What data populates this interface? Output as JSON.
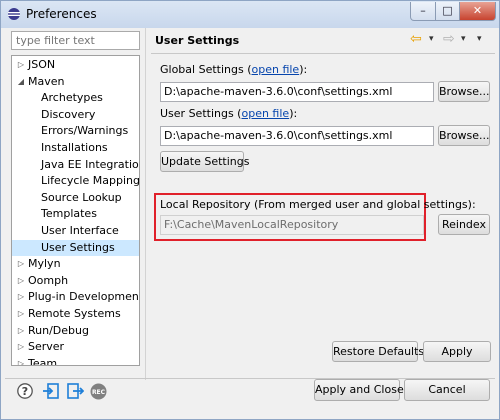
{
  "window": {
    "title": "Preferences",
    "min_glyph": "–",
    "max_glyph": "□",
    "close_glyph": "✕"
  },
  "filter": {
    "placeholder": "type filter text"
  },
  "tree": {
    "items": [
      {
        "label": "JSON",
        "expander": "▷",
        "level": 0
      },
      {
        "label": "Maven",
        "expander": "◢",
        "level": 0
      },
      {
        "label": "Archetypes",
        "expander": "",
        "level": 1
      },
      {
        "label": "Discovery",
        "expander": "",
        "level": 1
      },
      {
        "label": "Errors/Warnings",
        "expander": "",
        "level": 1
      },
      {
        "label": "Installations",
        "expander": "",
        "level": 1
      },
      {
        "label": "Java EE Integration",
        "expander": "",
        "level": 1
      },
      {
        "label": "Lifecycle Mappings",
        "expander": "",
        "level": 1
      },
      {
        "label": "Source Lookup",
        "expander": "",
        "level": 1
      },
      {
        "label": "Templates",
        "expander": "",
        "level": 1
      },
      {
        "label": "User Interface",
        "expander": "",
        "level": 1
      },
      {
        "label": "User Settings",
        "expander": "",
        "level": 1,
        "selected": true
      },
      {
        "label": "Mylyn",
        "expander": "▷",
        "level": 0
      },
      {
        "label": "Oomph",
        "expander": "▷",
        "level": 0
      },
      {
        "label": "Plug-in Development",
        "expander": "▷",
        "level": 0
      },
      {
        "label": "Remote Systems",
        "expander": "▷",
        "level": 0
      },
      {
        "label": "Run/Debug",
        "expander": "▷",
        "level": 0
      },
      {
        "label": "Server",
        "expander": "▷",
        "level": 0
      },
      {
        "label": "Team",
        "expander": "▷",
        "level": 0
      }
    ]
  },
  "page": {
    "title": "User Settings",
    "nav": {
      "back": "⇦",
      "back_menu": "▾",
      "forward": "⇨",
      "forward_menu": "▾",
      "view_menu": "▾"
    },
    "global_settings": {
      "label_prefix": "Global Settings (",
      "link": "open file",
      "label_suffix": "):",
      "value": "D:\\apache-maven-3.6.0\\conf\\settings.xml",
      "browse": "Browse..."
    },
    "user_settings": {
      "label_prefix": "User Settings (",
      "link": "open file",
      "label_suffix": "):",
      "value": "D:\\apache-maven-3.6.0\\conf\\settings.xml",
      "browse": "Browse..."
    },
    "update_button": "Update Settings",
    "local_repo": {
      "label": "Local Repository (From merged user and global settings):",
      "value": "F:\\Cache\\MavenLocalRepository",
      "reindex": "Reindex"
    },
    "restore_defaults": "Restore Defaults",
    "apply": "Apply"
  },
  "footer": {
    "apply_close": "Apply and Close",
    "cancel": "Cancel",
    "rec_badge": "REC"
  },
  "colors": {
    "highlight": "#e0202a",
    "selection": "#cce8ff",
    "link": "#0645ad",
    "nav_arrow": "#e8a000"
  }
}
